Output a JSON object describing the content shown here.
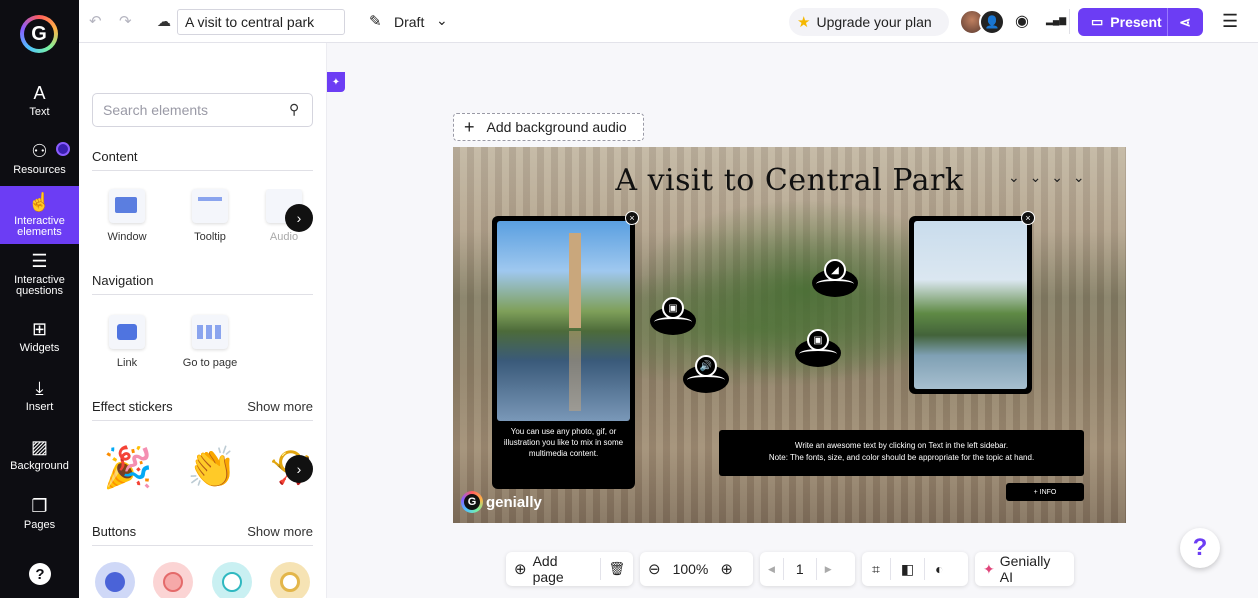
{
  "rail": {
    "logo": "G",
    "items": [
      {
        "label": "Text",
        "icon": "A"
      },
      {
        "label": "Resources",
        "icon": "⚇"
      },
      {
        "label": "Interactive elements",
        "icon": "☝"
      },
      {
        "label": "Interactive questions",
        "icon": "☰"
      },
      {
        "label": "Widgets",
        "icon": "⊞"
      },
      {
        "label": "Insert",
        "icon": "⤓"
      },
      {
        "label": "Background",
        "icon": "▨"
      },
      {
        "label": "Pages",
        "icon": "❐"
      }
    ],
    "help": "?"
  },
  "topbar": {
    "undo_icon": "↶",
    "redo_icon": "↷",
    "cloud_icon": "☁",
    "title_value": "A visit to central park",
    "pencil_icon": "✎",
    "status": "Draft",
    "status_chevron": "⌄",
    "upgrade_star": "★",
    "upgrade_label": "Upgrade your plan",
    "eye_icon": "◉",
    "stats_icon": "▂▄▆",
    "present_icon": "▭",
    "present_label": "Present",
    "share_icon": "⋖",
    "menu_icon": "☰"
  },
  "panel": {
    "search_placeholder": "Search elements",
    "search_icon": "⚲",
    "sections": {
      "content": {
        "title": "Content",
        "items": [
          "Window",
          "Tooltip",
          "Audio"
        ]
      },
      "navigation": {
        "title": "Navigation",
        "items": [
          "Link",
          "Go to page"
        ]
      },
      "effect_stickers": {
        "title": "Effect stickers",
        "more": "Show more",
        "items": [
          "🎉",
          "👏",
          "📯"
        ]
      },
      "buttons": {
        "title": "Buttons",
        "more": "Show more"
      }
    },
    "next_icon": "›"
  },
  "canvas": {
    "pin_icon": "✦",
    "bg_audio_plus": "+",
    "bg_audio_label": "Add background audio",
    "slide": {
      "title": "A visit to Central Park",
      "birds": "⌄ ⌄ ⌄ ⌄",
      "card1_text": "You can use any photo, gif, or illustration you like to mix in some multimedia content.",
      "close": "×",
      "textbox_line1": "Write an awesome text by clicking on Text in the left sidebar.",
      "textbox_line2": "Note: The fonts, size, and color should be appropriate for the topic at hand.",
      "info_button": "+ INFO",
      "brand_logo": "G",
      "brand_name": "genially",
      "hotspot_icons": [
        "▣",
        "◢",
        "🔊",
        "▣"
      ]
    }
  },
  "bottombar": {
    "add_page_icon": "⊕",
    "add_page_label": "Add page",
    "delete_icon": "🗑",
    "zoom_out_icon": "⊖",
    "zoom": "100%",
    "zoom_in_icon": "⊕",
    "prev_icon": "◀",
    "page": "1",
    "next_icon": "▶",
    "fit_icon": "⌗",
    "compare_icon": "◧",
    "theme_icon": "◐",
    "ai_icon": "✦",
    "ai_label": "Genially AI"
  },
  "help_fab": "?",
  "colors": {
    "accent": "#6c3df4",
    "rail_bg": "#0d0d12"
  }
}
